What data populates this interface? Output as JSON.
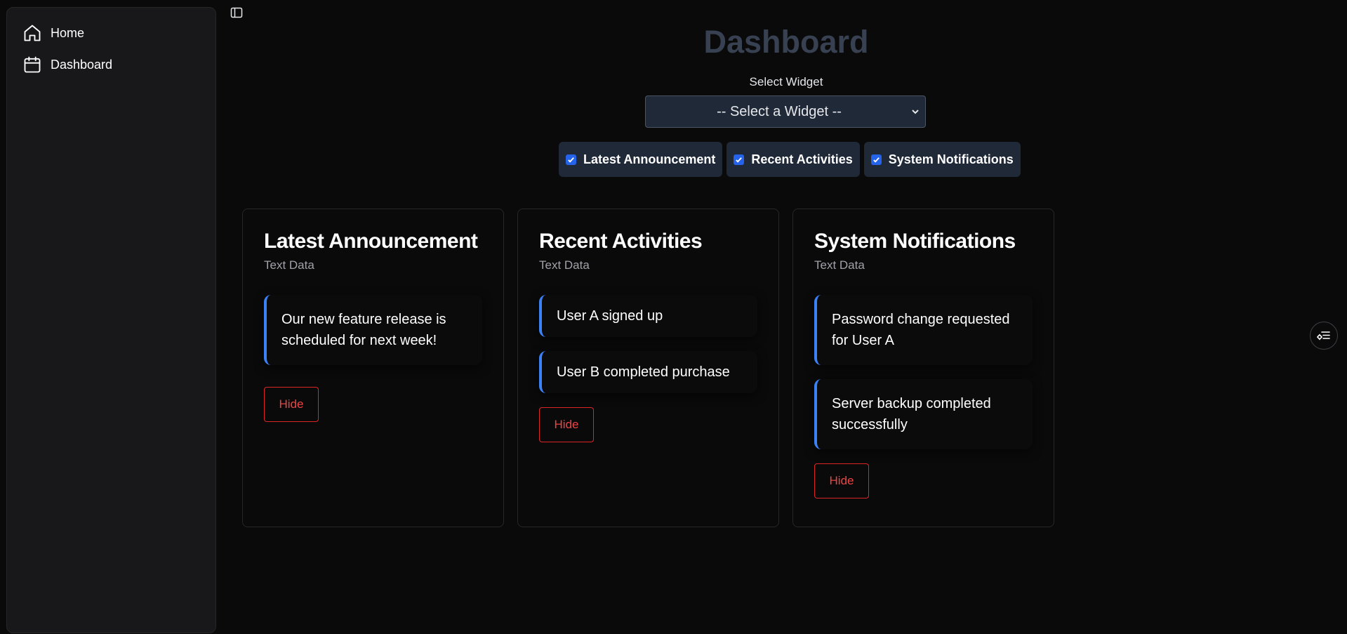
{
  "sidebar": {
    "items": [
      {
        "label": "Home",
        "icon": "home-icon"
      },
      {
        "label": "Dashboard",
        "icon": "calendar-icon"
      }
    ]
  },
  "header": {
    "title": "Dashboard",
    "select_label": "Select Widget",
    "select_value": "-- Select a Widget --"
  },
  "toggles": [
    {
      "label": "Latest Announcement",
      "checked": true
    },
    {
      "label": "Recent Activities",
      "checked": true
    },
    {
      "label": "System Notifications",
      "checked": true
    }
  ],
  "cards": [
    {
      "title": "Latest Announcement",
      "subtitle": "Text Data",
      "items": [
        "Our new feature release is scheduled for next week!"
      ],
      "hide_label": "Hide"
    },
    {
      "title": "Recent Activities",
      "subtitle": "Text Data",
      "items": [
        "User A signed up",
        "User B completed purchase"
      ],
      "hide_label": "Hide"
    },
    {
      "title": "System Notifications",
      "subtitle": "Text Data",
      "items": [
        "Password change requested for User A",
        "Server backup completed successfully"
      ],
      "hide_label": "Hide"
    }
  ],
  "colors": {
    "accent": "#3b82f6",
    "danger": "#ef4444",
    "background": "#0a0a0a",
    "sidebar": "#18181b",
    "chip": "#1f2937",
    "title_muted": "#374151"
  }
}
